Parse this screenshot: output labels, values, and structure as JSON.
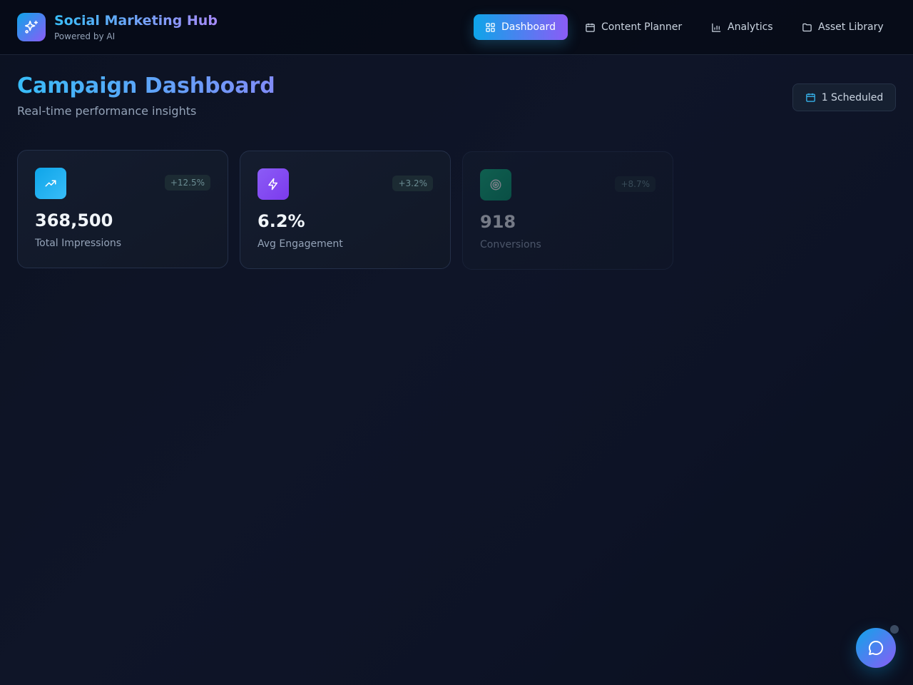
{
  "app": {
    "title": "Social Marketing Hub",
    "subtitle": "Powered by AI",
    "logo_icon": "sparkles-icon"
  },
  "nav": {
    "items": [
      {
        "label": "Dashboard",
        "icon": "grid-icon",
        "active": true
      },
      {
        "label": "Content Planner",
        "icon": "calendar-icon",
        "active": false
      },
      {
        "label": "Analytics",
        "icon": "bar-chart-icon",
        "active": false
      },
      {
        "label": "Asset Library",
        "icon": "folder-icon",
        "active": false
      }
    ]
  },
  "page": {
    "title": "Campaign Dashboard",
    "subtitle": "Real-time performance insights",
    "scheduled_label": "1 Scheduled"
  },
  "stats": [
    {
      "value": "368,500",
      "label": "Total Impressions",
      "delta": "+12.5%",
      "icon": "trending-up-icon",
      "color": "#0ea5e9"
    },
    {
      "value": "6.2%",
      "label": "Avg Engagement",
      "delta": "+3.2%",
      "icon": "lightning-icon",
      "color": "#8b5cf6"
    },
    {
      "value": "918",
      "label": "Conversions",
      "delta": "+8.7%",
      "icon": "target-icon",
      "color": "#10b981"
    }
  ],
  "chat": {
    "icon": "chat-bubble-icon"
  },
  "colors": {
    "accent_start": "#0ea5e9",
    "accent_end": "#8b5cf6",
    "background": "#0c1222"
  }
}
